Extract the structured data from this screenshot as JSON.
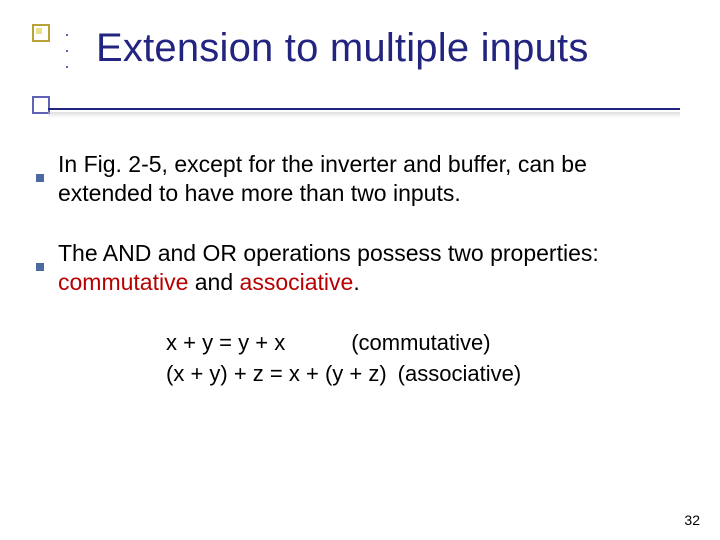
{
  "title": "Extension to multiple inputs",
  "bullets": [
    {
      "text": "In Fig. 2-5, except for the inverter and buffer, can be extended to have more than two inputs."
    },
    {
      "pre": "The AND and OR operations possess two properties: ",
      "em1": "commutative",
      "mid": " and ",
      "em2": "associative",
      "post": "."
    }
  ],
  "equations": {
    "line1": "x + y = y + x   (commutative)",
    "line2": "(x + y) + z = x + (y + z) (associative)"
  },
  "page_number": "32"
}
